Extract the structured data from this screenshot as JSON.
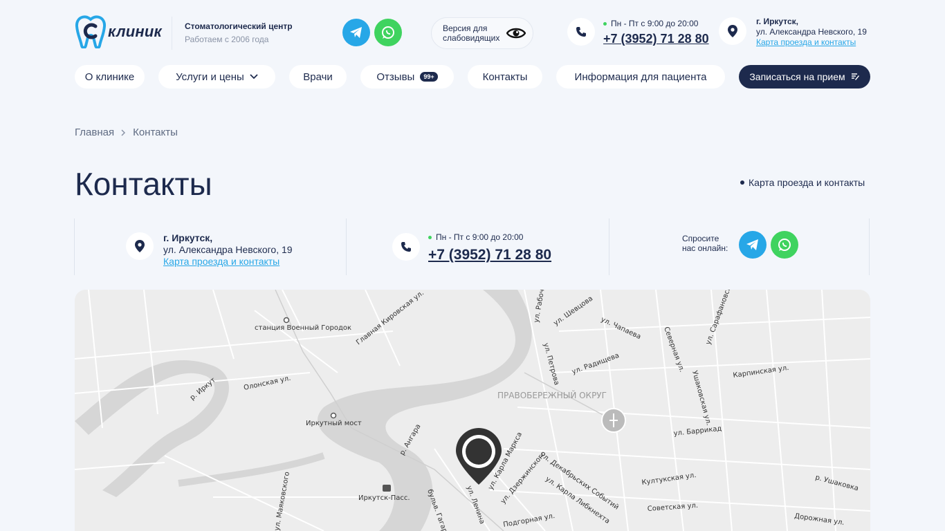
{
  "header": {
    "logo_text": "клиник",
    "tagline_title": "Стоматологический центр",
    "tagline_sub": "Работаем с 2006 года",
    "accessibility_label": "Версия для слабовидящих",
    "hours": "Пн - Пт с 9:00 до 20:00",
    "phone": "+7 (3952) 71 28 80",
    "city": "г. Иркутск,",
    "street": "ул. Александра Невского, 19",
    "map_link": "Карта проезда и контакты"
  },
  "nav": {
    "items": [
      {
        "label": "О клинике"
      },
      {
        "label": "Услуги и цены"
      },
      {
        "label": "Врачи"
      },
      {
        "label": "Отзывы",
        "badge": "99+"
      },
      {
        "label": "Контакты"
      },
      {
        "label": "Информация для пациента"
      }
    ],
    "cta": "Записаться на прием"
  },
  "breadcrumb": {
    "home": "Главная",
    "current": "Контакты"
  },
  "page": {
    "title": "Контакты",
    "map_link": "Карта проезда и контакты"
  },
  "contacts": {
    "city": "г. Иркутск,",
    "street": "ул. Александра Невского, 19",
    "map_link": "Карта проезда и контакты",
    "hours": "Пн - Пт с 9:00 до 20:00",
    "phone": "+7 (3952) 71 28 80",
    "ask_online": "Спросите нас онлайн:"
  },
  "map": {
    "labels": [
      "станция Военный Городок",
      "Главная Кировская ул.",
      "Олонская ул.",
      "р. Иркут",
      "Иркутный мост",
      "р. Ангара",
      "Иркутск-Пасс.",
      "бульв. Гагарина",
      "ул. Ленина",
      "ул. Карла Маркса",
      "ул. Дзержинского",
      "ул. Декабрьских Событий",
      "ул. Карла Либкнехта",
      "Подгорная ул.",
      "ПРАВОБЕРЕЖНЫЙ ОКРУГ",
      "ул. Шевцова",
      "ул. Чапаева",
      "ул. Петрова",
      "ул. Радищева",
      "ул. Рабочая",
      "Северная ул.",
      "Ушаковская ул.",
      "Карпинская ул.",
      "ул. Сарафановская",
      "ул. Баррикад",
      "Култукская ул.",
      "Советская ул.",
      "Дорожная ул.",
      "р. Ушаковка",
      "ул. Маяковского"
    ]
  },
  "colors": {
    "navy": "#1d2a4d",
    "telegram": "#27a7e7",
    "whatsapp": "#3fd35f",
    "link": "#27a7e7",
    "background": "#f3f6fb"
  }
}
